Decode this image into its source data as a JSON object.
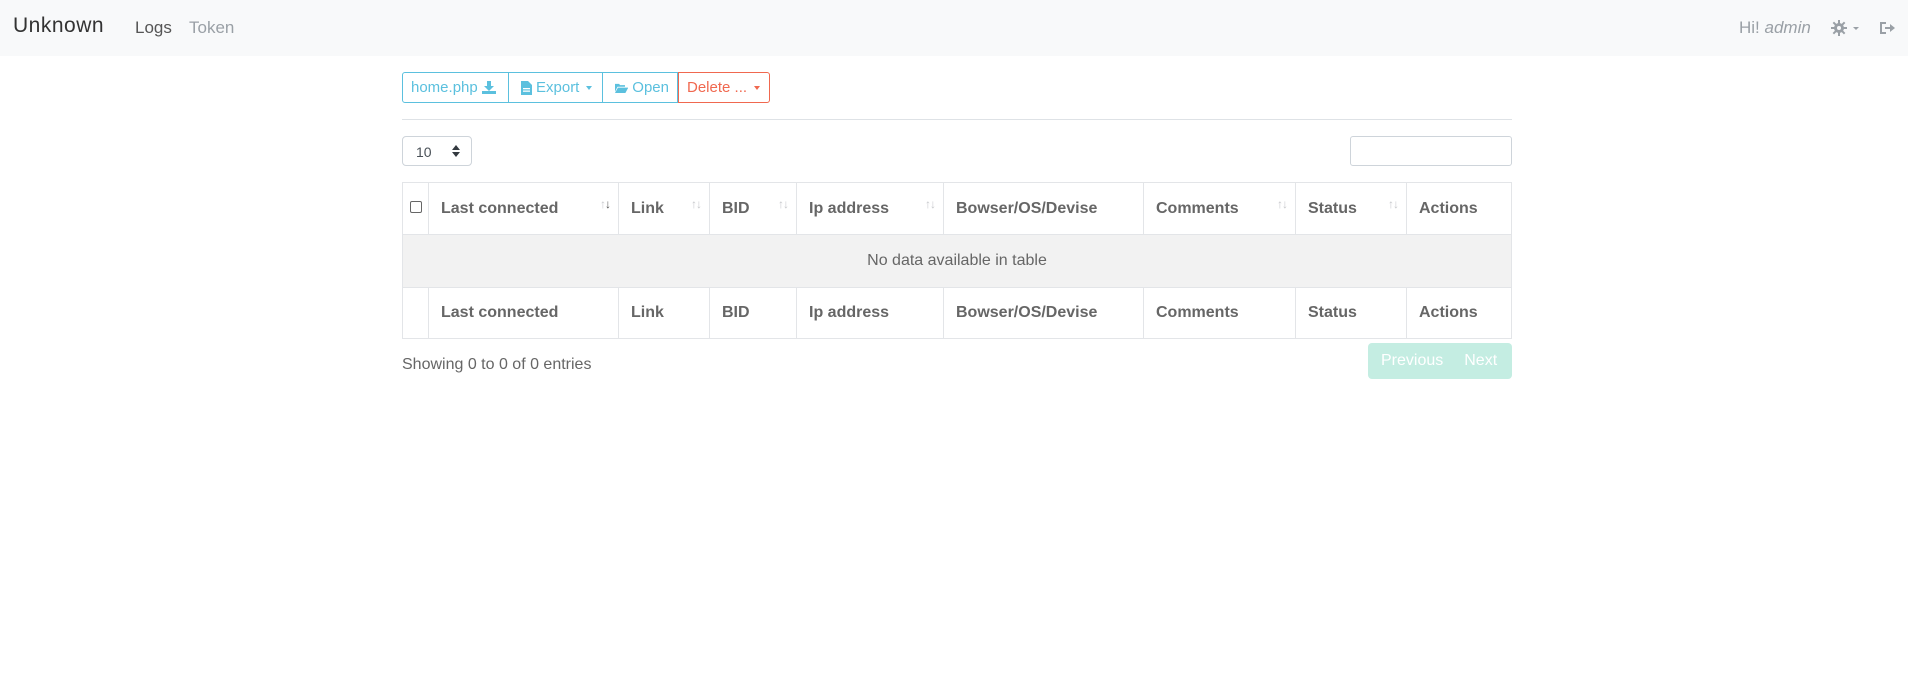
{
  "nav": {
    "brand": "Unknown",
    "links": [
      "Logs",
      "Token"
    ],
    "greeting": "Hi!",
    "user": "admin"
  },
  "toolbar": {
    "file_label": "home.php",
    "export_label": "Export",
    "open_label": "Open",
    "delete_label": "Delete ..."
  },
  "table": {
    "length_value": "10",
    "search_value": "",
    "columns": [
      "Last connected",
      "Link",
      "BID",
      "Ip address",
      "Bowser/OS/Devise",
      "Comments",
      "Status",
      "Actions"
    ],
    "empty_message": "No data available in table",
    "info": "Showing 0 to 0 of 0 entries",
    "prev_label": "Previous",
    "next_label": "Next"
  },
  "colors": {
    "info": "#5bc0de",
    "danger": "#f0684f",
    "pager": "#c4ede2",
    "navbar": "#f8f9fa"
  },
  "icons": [
    "download-icon",
    "file-icon",
    "folder-open-icon",
    "gear-icon",
    "logout-icon",
    "sort-icon"
  ]
}
